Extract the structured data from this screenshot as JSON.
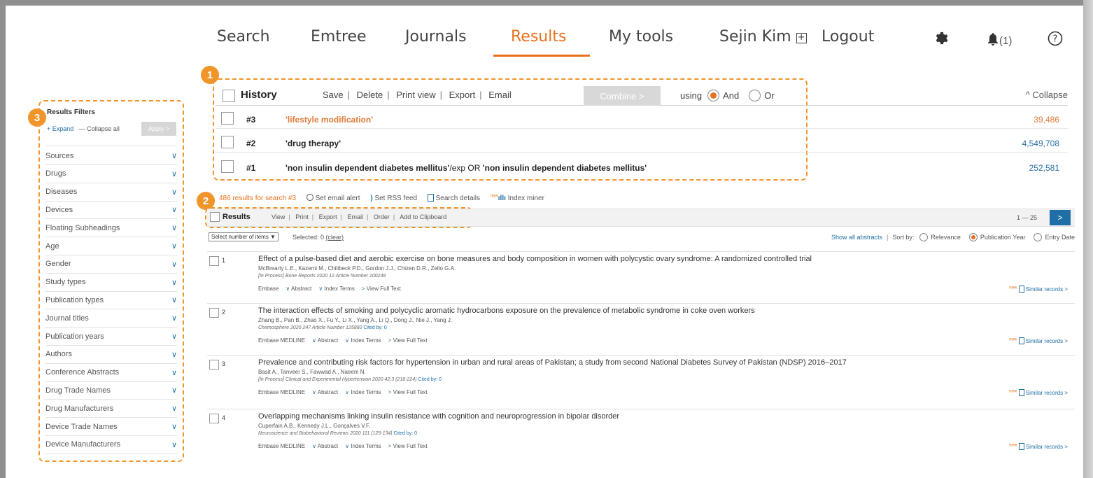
{
  "nav": {
    "search": "Search",
    "emtree": "Emtree",
    "journals": "Journals",
    "results": "Results",
    "mytools": "My tools",
    "user": "Sejin Kim",
    "logout": "Logout",
    "notifications": "(1)"
  },
  "callouts": {
    "one": "1",
    "two": "2",
    "three": "3"
  },
  "sidebar": {
    "title": "Results Filters",
    "expand": "+ Expand",
    "collapse_all": "— Collapse all",
    "apply": "Apply >",
    "filters": [
      "Sources",
      "Drugs",
      "Diseases",
      "Devices",
      "Floating Subheadings",
      "Age",
      "Gender",
      "Study types",
      "Publication types",
      "Journal titles",
      "Publication years",
      "Authors",
      "Conference Abstracts",
      "Drug Trade Names",
      "Drug Manufacturers",
      "Device Trade Names",
      "Device Manufacturers"
    ]
  },
  "history": {
    "title": "History",
    "actions": [
      "Save",
      "Delete",
      "Print view",
      "Export",
      "Email"
    ],
    "combine": "Combine >",
    "using": "using",
    "and": "And",
    "or": "Or",
    "collapse": "Collapse",
    "rows": [
      {
        "num": "#3",
        "query": "'lifestyle modification'",
        "count": "39,486"
      },
      {
        "num": "#2",
        "query": "'drug therapy'",
        "count": "4,549,708"
      },
      {
        "num": "#1",
        "query_a": "'non insulin dependent diabetes mellitus'",
        "query_b": "/exp OR ",
        "query_c": "'non insulin dependent diabetes mellitus'",
        "count": "252,581"
      }
    ]
  },
  "results": {
    "count_text": "486 results for search #3",
    "email_alert": "Set email alert",
    "rss": "Set RSS feed",
    "search_details": "Search details",
    "new": "new",
    "index_miner": "Index miner",
    "label": "Results",
    "actions": [
      "View",
      "Print",
      "Export",
      "Email",
      "Order",
      "Add to Clipboard"
    ],
    "pager": "1 — 25",
    "select_items": "Select number of items",
    "selected": "Selected: 0",
    "clear": "(clear)",
    "show_abstracts": "Show all abstracts",
    "sort_by": "Sort by:",
    "sort_relevance": "Relevance",
    "sort_pubyear": "Publication Year",
    "sort_entry": "Entry Date",
    "similar": "Similar records >",
    "records": [
      {
        "num": "1",
        "title": "Effect of a pulse-based diet and aerobic exercise on bone measures and body composition in women with polycystic ovary syndrome: A randomized controlled trial",
        "authors": "McBrearty L.E., Kazemi M., Chilibeck P.D., Gordon J.J., Chizen D.R., Zello G.A.",
        "source": "[In Process] Bone Reports 2020 12 Article Number 100248",
        "cited": "",
        "sources": "Embase",
        "abstract": "Abstract",
        "index_terms": "Index Terms",
        "full_text": "View Full Text"
      },
      {
        "num": "2",
        "title": "The interaction effects of smoking and polycyclic aromatic hydrocarbons exposure on the prevalence of metabolic syndrome in coke oven workers",
        "authors": "Zhang B., Pan B., Zhao X., Fu Y., Li X., Yang A., Li Q., Dong J., Nie J., Yang J.",
        "source": "Chemosphere 2020 247 Article Number 125880",
        "cited": "Cited by: 0",
        "sources": "Embase   MEDLINE",
        "abstract": "Abstract",
        "index_terms": "Index Terms",
        "full_text": "View Full Text"
      },
      {
        "num": "3",
        "title": "Prevalence and contributing risk factors for hypertension in urban and rural areas of Pakistan; a study from second National Diabetes Survey of Pakistan (NDSP) 2016–2017",
        "authors": "Basit A., Tanveer S., Fawwad A., Naeem N.",
        "source": "[In Process] Clinical and Experimental Hypertension 2020 42:3 (218-224)",
        "cited": "Cited by: 0",
        "sources": "Embase   MEDLINE",
        "abstract": "Abstract",
        "index_terms": "Index Terms",
        "full_text": "View Full Text"
      },
      {
        "num": "4",
        "title": "Overlapping mechanisms linking insulin resistance with cognition and neuroprogression in bipolar disorder",
        "authors": "Cuperfain A.B., Kennedy J.L., Gonçalves V.F.",
        "source": "Neuroscience and Biobehavioral Reviews 2020 111 (125-134)",
        "cited": "Cited by: 0",
        "sources": "Embase   MEDLINE",
        "abstract": "Abstract",
        "index_terms": "Index Terms",
        "full_text": "View Full Text"
      }
    ]
  },
  "colors": {
    "accent": "#e9711c",
    "callout": "#f0952a",
    "link": "#1f6fa6"
  }
}
